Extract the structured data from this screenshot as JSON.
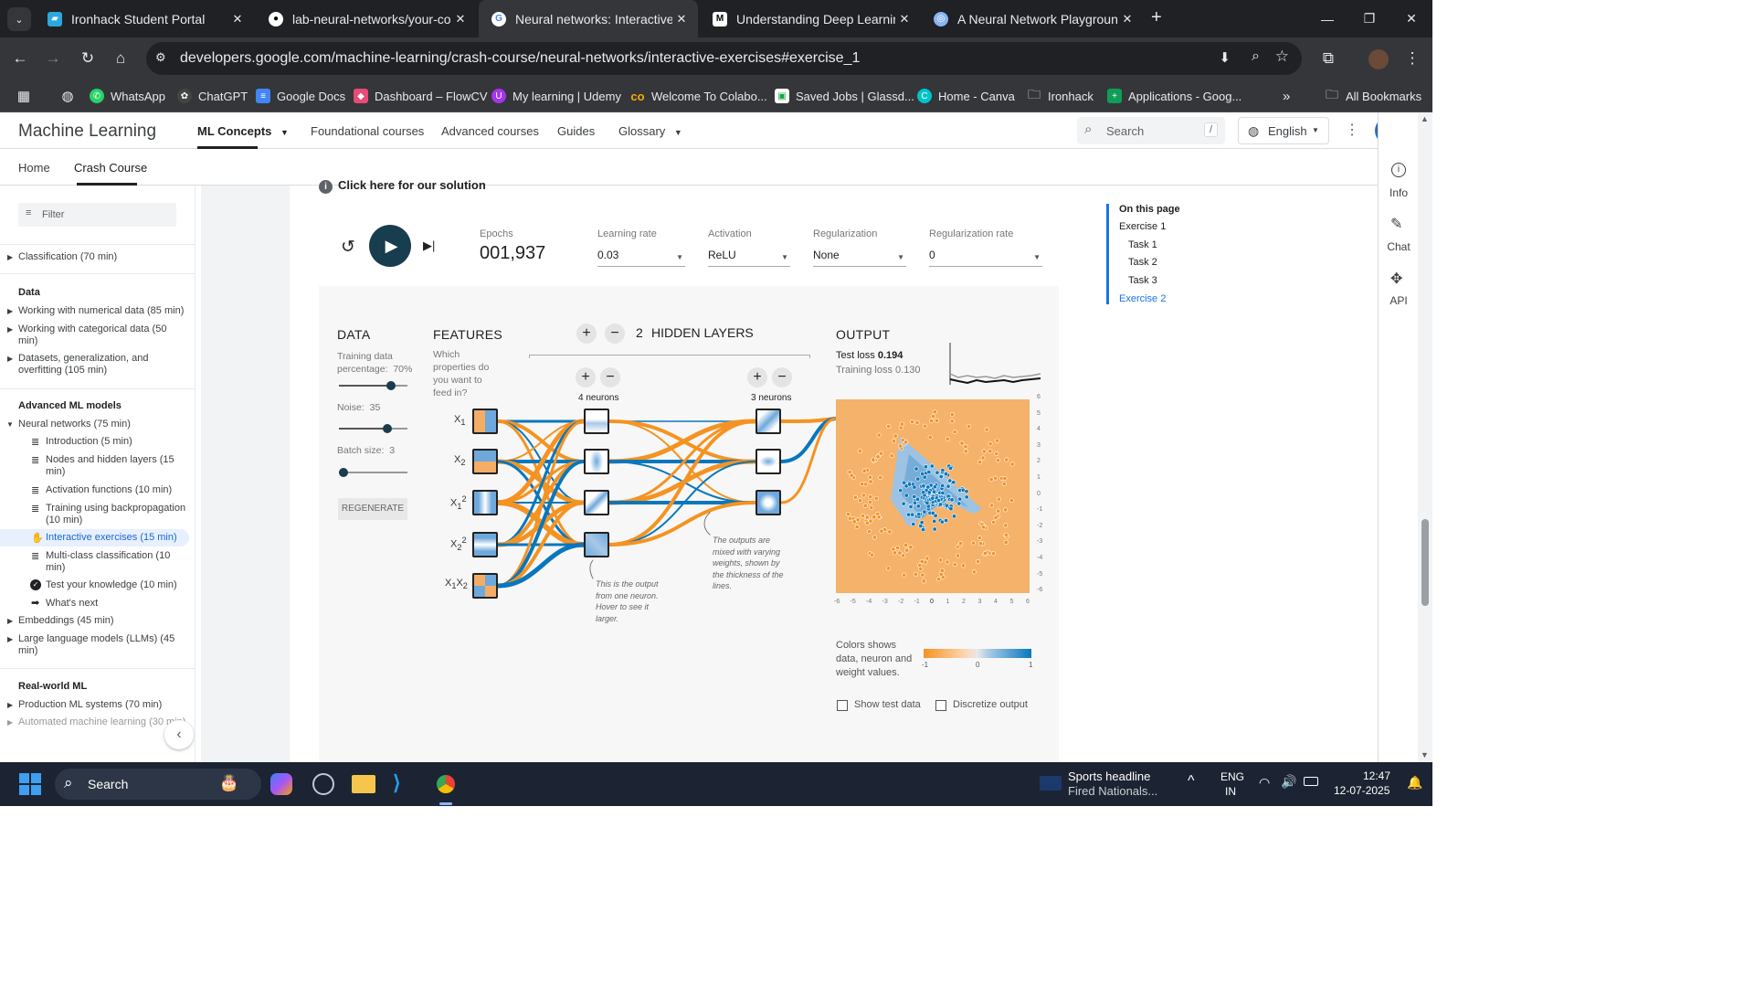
{
  "browser": {
    "tabs": [
      {
        "title": "Ironhack Student Portal",
        "icon": "ironhack-icon",
        "color": "#2ba8e0"
      },
      {
        "title": "lab-neural-networks/your-code",
        "icon": "github-icon",
        "color": "#ffffff"
      },
      {
        "title": "Neural networks: Interactive exe",
        "icon": "google-icon",
        "color": "#ffffff"
      },
      {
        "title": "Understanding Deep Learning v",
        "icon": "medium-icon",
        "color": "#ffffff"
      },
      {
        "title": "A Neural Network Playground",
        "icon": "playground-icon",
        "color": "#8ab4f8"
      }
    ],
    "new_tab": "+",
    "url": "developers.google.com/machine-learning/crash-course/neural-networks/interactive-exercises#exercise_1",
    "bookmarks": [
      {
        "label": "WhatsApp",
        "color": "#25d366"
      },
      {
        "label": "ChatGPT",
        "color": "#e8eaed"
      },
      {
        "label": "Google Docs",
        "color": "#4285f4"
      },
      {
        "label": "Dashboard – FlowCV",
        "color": "#e84a7a"
      },
      {
        "label": "My learning | Udemy",
        "color": "#a435f0"
      },
      {
        "label": "Welcome To Colabo...",
        "color": "#f9ab00"
      },
      {
        "label": "Saved Jobs | Glassd...",
        "color": "#ffffff"
      },
      {
        "label": "Home - Canva",
        "color": "#00c4cc"
      },
      {
        "label": "Ironhack",
        "color": "#e8eaed"
      },
      {
        "label": "Applications - Goog...",
        "color": "#0f9d58"
      }
    ],
    "all_bookmarks": "All Bookmarks"
  },
  "site": {
    "brand": "Machine Learning",
    "nav": [
      "ML Concepts",
      "Foundational courses",
      "Advanced courses",
      "Guides",
      "Glossary"
    ],
    "search_placeholder": "Search",
    "search_key": "/",
    "language": "English",
    "subnav": [
      "Home",
      "Crash Course"
    ]
  },
  "sidebar": {
    "filter_placeholder": "Filter",
    "items": [
      {
        "label": "Classification (70 min)"
      },
      {
        "header": "Data"
      },
      {
        "label": "Working with numerical data (85 min)"
      },
      {
        "label": "Working with categorical data (50 min)"
      },
      {
        "label": "Datasets, generalization, and overfitting (105 min)"
      },
      {
        "header": "Advanced ML models"
      },
      {
        "label": "Neural networks (75 min)"
      },
      {
        "label": "Introduction (5 min)"
      },
      {
        "label": "Nodes and hidden layers (15 min)"
      },
      {
        "label": "Activation functions (10 min)"
      },
      {
        "label": "Training using backpropagation (10 min)"
      },
      {
        "label": "Interactive exercises (15 min)"
      },
      {
        "label": "Multi-class classification (10 min)"
      },
      {
        "label": "Test your knowledge (10 min)"
      },
      {
        "label": "What's next"
      },
      {
        "label": "Embeddings (45 min)"
      },
      {
        "label": "Large language models (LLMs) (45 min)"
      },
      {
        "header": "Real-world ML"
      },
      {
        "label": "Production ML systems (70 min)"
      },
      {
        "label": "Automated machine learning (30 min)"
      }
    ]
  },
  "toc": {
    "title": "On this page",
    "items": [
      "Exercise 1",
      "Task 1",
      "Task 2",
      "Task 3",
      "Exercise 2"
    ]
  },
  "rail": [
    "Info",
    "Chat",
    "API"
  ],
  "content": {
    "solution_link": "Click here for our solution"
  },
  "playground": {
    "epochs_label": "Epochs",
    "epochs": "001,937",
    "learning_rate_label": "Learning rate",
    "learning_rate": "0.03",
    "activation_label": "Activation",
    "activation": "ReLU",
    "regularization_label": "Regularization",
    "regularization": "None",
    "reg_rate_label": "Regularization rate",
    "reg_rate": "0",
    "data_title": "DATA",
    "train_pct_label": "Training data percentage:",
    "train_pct": "70%",
    "train_pct_value": 70,
    "noise_label": "Noise:",
    "noise": "35",
    "noise_value": 35,
    "batch_label": "Batch size:",
    "batch": "3",
    "batch_value": 3,
    "regenerate": "REGENERATE",
    "features_title": "FEATURES",
    "features_question": "Which properties do you want to feed in?",
    "features": [
      "X1",
      "X2",
      "X1²",
      "X2²",
      "X1X2"
    ],
    "hidden_layers_count": "2",
    "hidden_layers_label": "HIDDEN LAYERS",
    "layer1_neurons": "4 neurons",
    "layer2_neurons": "3 neurons",
    "note1": "This is the output from one neuron. Hover to see it larger.",
    "note2": "The outputs are mixed with varying weights, shown by the thickness of the lines.",
    "output_title": "OUTPUT",
    "test_loss_label": "Test loss",
    "test_loss": "0.194",
    "train_loss_label": "Training loss",
    "train_loss": "0.130",
    "y_ticks": [
      "6",
      "5",
      "4",
      "3",
      "2",
      "1",
      "0",
      "-1",
      "-2",
      "-3",
      "-4",
      "-5",
      "-6"
    ],
    "x_ticks": [
      "-6",
      "-5",
      "-4",
      "-3",
      "-2",
      "-1",
      "0",
      "1",
      "2",
      "3",
      "4",
      "5",
      "6"
    ],
    "colors_legend": "Colors shows data, neuron and weight values.",
    "legend_ticks": [
      "-1",
      "0",
      "1"
    ],
    "show_test": "Show test data",
    "discretize": "Discretize output",
    "orange": "#f59322",
    "blue": "#0877bd"
  },
  "taskbar": {
    "search": "Search",
    "news_title": "Sports headline",
    "news_sub": "Fired Nationals...",
    "lang1": "ENG",
    "lang2": "IN",
    "time": "12:47",
    "date": "12-07-2025"
  }
}
